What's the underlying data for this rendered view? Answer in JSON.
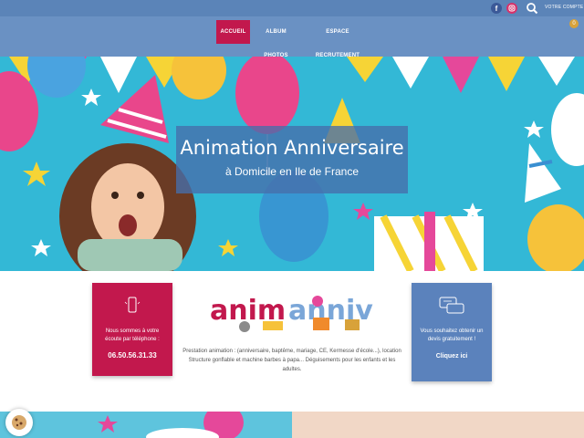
{
  "topbar": {
    "facebook_icon": "facebook-icon",
    "instagram_icon": "instagram-icon",
    "search_icon": "search-icon",
    "account_label": "VOTRE COMPTE"
  },
  "nav": {
    "items": [
      {
        "label": "ACCUEIL",
        "active": true
      },
      {
        "label": "ALBUM PHOTOS",
        "active": false
      },
      {
        "label": "ESPACE RECRUTEMENT",
        "active": false
      }
    ],
    "cart_count": "0"
  },
  "hero": {
    "title": "Animation Anniversaire",
    "subtitle": "à Domicile en Ile de France"
  },
  "contact_card": {
    "text": "Nous sommes à votre écoute par téléphone :",
    "phone": "06.50.56.31.33"
  },
  "devis_card": {
    "text": "Vous souhaitez obtenir un devis gratuitement !",
    "cta": "Cliquez ici"
  },
  "logo": {
    "text": "anim'anniv"
  },
  "description": "Prestation animation : (anniversaire, baptême, mariage, CE, Kermesse d'école...), location Structure gonflable et machine barbes à papa... Déguisements pour les enfants et les adultes.",
  "colors": {
    "primary_pink": "#c2184d",
    "nav_blue": "#6a91c3",
    "card_blue": "#5b82bc",
    "hero_sky": "#33b8d6"
  }
}
